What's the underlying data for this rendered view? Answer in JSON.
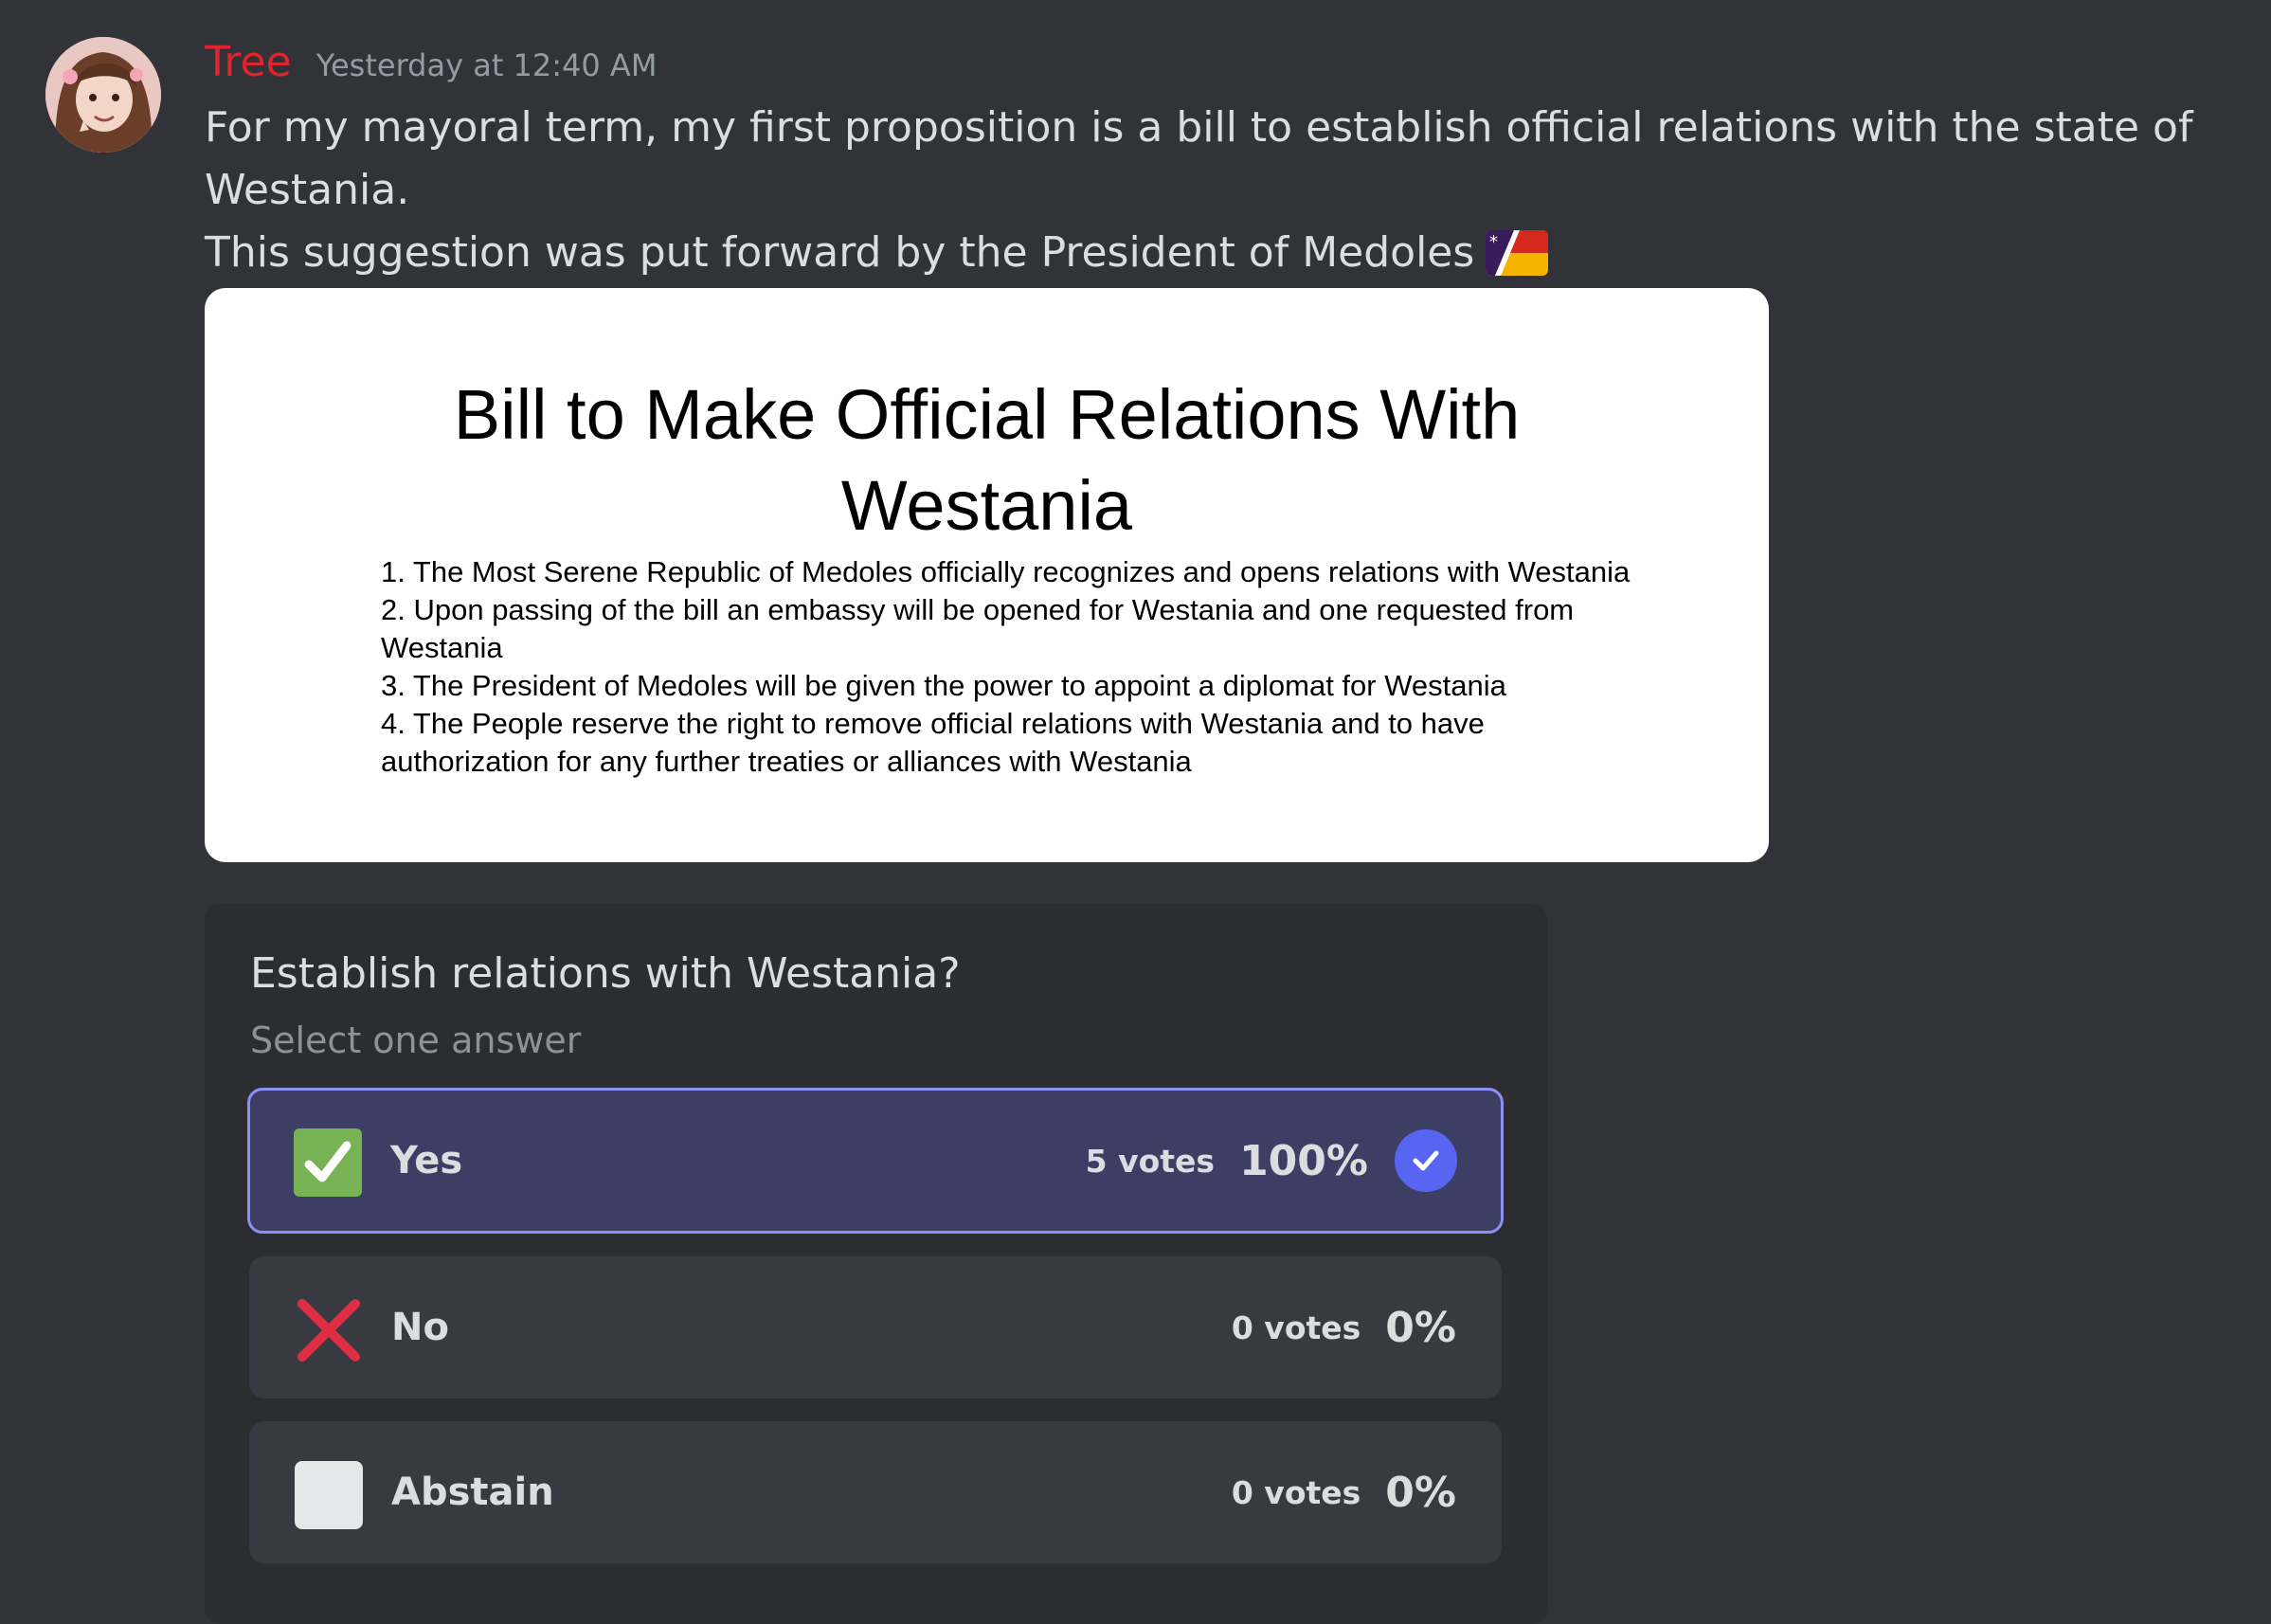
{
  "message": {
    "username": "Tree",
    "timestamp": "Yesterday at 12:40 AM",
    "line1": "For my mayoral term, my first proposition is a bill to establish official relations with the state of",
    "line2": "Westania.",
    "line3": "This suggestion was put forward by the President of Medoles",
    "username_color": "#e0242d"
  },
  "document": {
    "title_line1": "Bill to Make Official Relations With",
    "title_line2": "Westania",
    "items": [
      "1. The Most Serene Republic of Medoles officially recognizes and opens relations with Westania",
      "2. Upon passing of the bill an embassy will be opened for Westania and one requested from",
      "Westania",
      "3. The President of Medoles will be given the power to appoint a diplomat for Westania",
      "4. The People reserve the right to remove official relations with Westania and to have",
      "authorization for any further treaties or alliances with Westania"
    ]
  },
  "poll": {
    "question": "Establish relations with Westania?",
    "subtitle": "Select one answer",
    "options": [
      {
        "label": "Yes",
        "votes": "5 votes",
        "percent": "100%",
        "icon": "white-check-mark-icon",
        "selected": true
      },
      {
        "label": "No",
        "votes": "0 votes",
        "percent": "0%",
        "icon": "red-x-icon",
        "selected": false
      },
      {
        "label": "Abstain",
        "votes": "0 votes",
        "percent": "0%",
        "icon": "white-square-icon",
        "selected": false
      }
    ]
  },
  "colors": {
    "background": "#313338",
    "poll_background": "#2b2d31",
    "selected_border": "#8c91f0",
    "accent": "#5865f2"
  }
}
